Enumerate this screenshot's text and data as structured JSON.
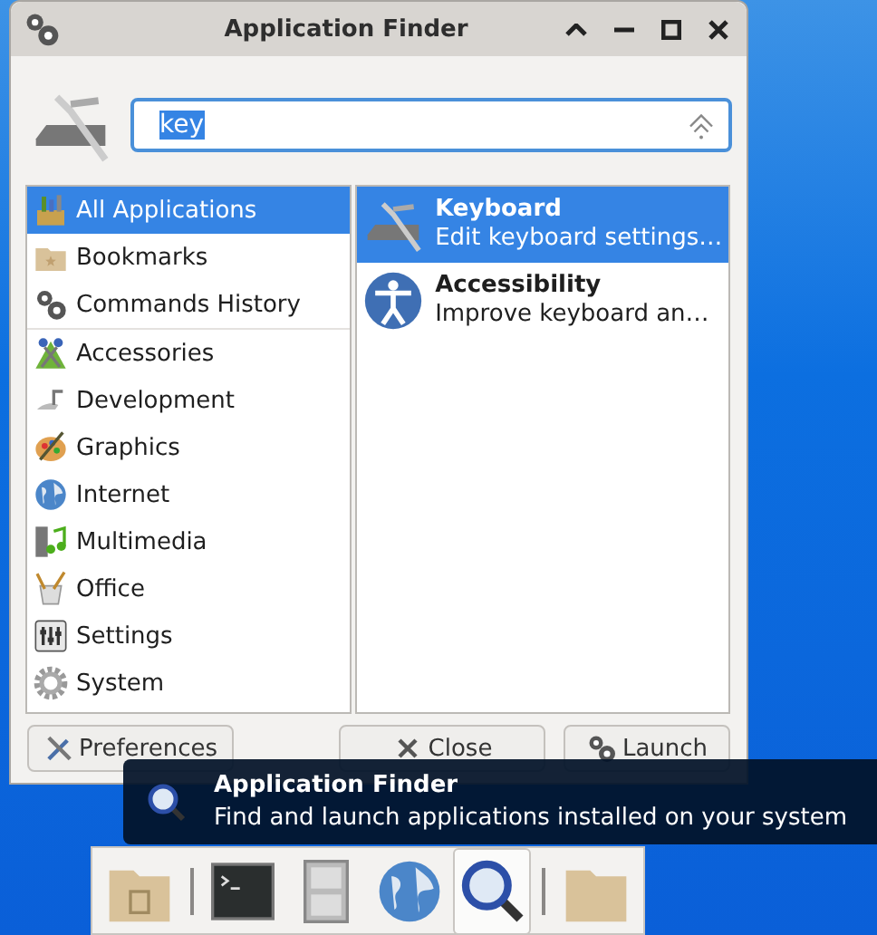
{
  "window": {
    "title": "Application Finder"
  },
  "search": {
    "value": "key",
    "selected_text": true
  },
  "categories": [
    {
      "label": "All Applications",
      "selected": true,
      "separator_after": false
    },
    {
      "label": "Bookmarks",
      "selected": false,
      "separator_after": false
    },
    {
      "label": "Commands History",
      "selected": false,
      "separator_after": true
    },
    {
      "label": "Accessories",
      "selected": false,
      "separator_after": false
    },
    {
      "label": "Development",
      "selected": false,
      "separator_after": false
    },
    {
      "label": "Graphics",
      "selected": false,
      "separator_after": false
    },
    {
      "label": "Internet",
      "selected": false,
      "separator_after": false
    },
    {
      "label": "Multimedia",
      "selected": false,
      "separator_after": false
    },
    {
      "label": "Office",
      "selected": false,
      "separator_after": false
    },
    {
      "label": "Settings",
      "selected": false,
      "separator_after": false
    },
    {
      "label": "System",
      "selected": false,
      "separator_after": false
    }
  ],
  "results": [
    {
      "name": "Keyboard",
      "description": "Edit keyboard settings…",
      "selected": true
    },
    {
      "name": "Accessibility",
      "description": "Improve keyboard an…",
      "selected": false
    }
  ],
  "buttons": [
    "Preferences",
    "Close",
    "Launch"
  ],
  "tooltip": {
    "title": "Application Finder",
    "text": "Find and launch applications installed on your system"
  },
  "dock": [
    {
      "launchers": [
        {
          "active": false
        }
      ]
    },
    {
      "launchers": [
        {
          "active": false
        },
        {
          "active": false
        },
        {
          "active": false
        },
        {
          "active": true
        }
      ]
    },
    {
      "launchers": [
        {
          "active": false
        }
      ]
    }
  ]
}
